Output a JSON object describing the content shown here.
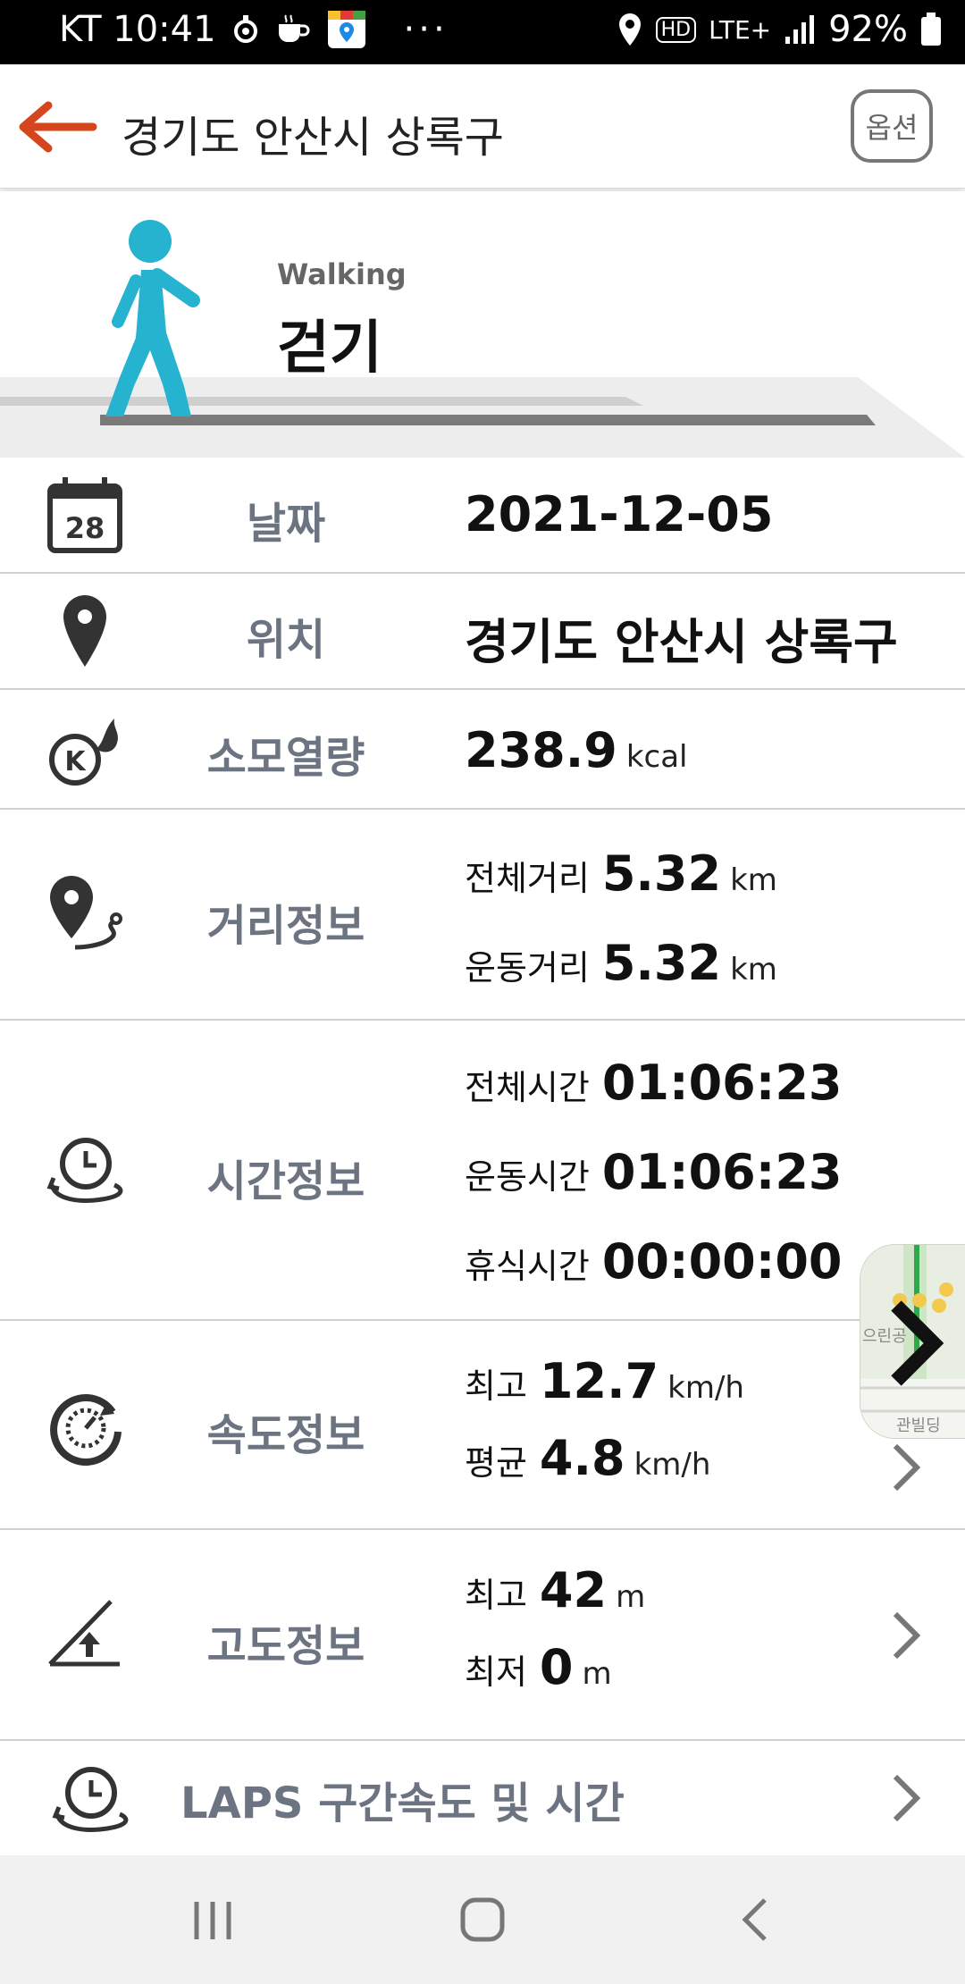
{
  "status_bar": {
    "carrier_time": "KT 10:41",
    "network": "LTE+",
    "hd": "HD",
    "battery": "92%"
  },
  "header": {
    "title": "경기도 안산시 상록구",
    "options_label": "옵션"
  },
  "activity": {
    "type_en": "Walking",
    "type_ko": "걷기",
    "accent_color": "#25b3cf"
  },
  "rows": {
    "date": {
      "label": "날짜",
      "value": "2021-12-05",
      "calendar_day": "28"
    },
    "location": {
      "label": "위치",
      "value": "경기도 안산시 상록구"
    },
    "calories": {
      "label": "소모열량",
      "value": "238.9",
      "unit": "kcal"
    },
    "distance": {
      "label": "거리정보",
      "total_label": "전체거리",
      "total_value": "5.32",
      "total_unit": "km",
      "exercise_label": "운동거리",
      "exercise_value": "5.32",
      "exercise_unit": "km"
    },
    "time": {
      "label": "시간정보",
      "total_label": "전체시간",
      "total_value": "01:06:23",
      "exercise_label": "운동시간",
      "exercise_value": "01:06:23",
      "rest_label": "휴식시간",
      "rest_value": "00:00:00"
    },
    "speed": {
      "label": "속도정보",
      "max_label": "최고",
      "max_value": "12.7",
      "max_unit": "km/h",
      "avg_label": "평균",
      "avg_value": "4.8",
      "avg_unit": "km/h"
    },
    "altitude": {
      "label": "고도정보",
      "max_label": "최고",
      "max_value": "42",
      "max_unit": "m",
      "min_label": "최저",
      "min_value": "0",
      "min_unit": "m"
    },
    "laps": {
      "label": "LAPS 구간속도 및 시간"
    }
  },
  "map_thumb": {
    "label_top": "으린공",
    "label_bottom": "관빌딩"
  },
  "colors": {
    "back_arrow": "#d6461c",
    "label_gray": "#6b7480",
    "walker": "#25b3cf"
  }
}
